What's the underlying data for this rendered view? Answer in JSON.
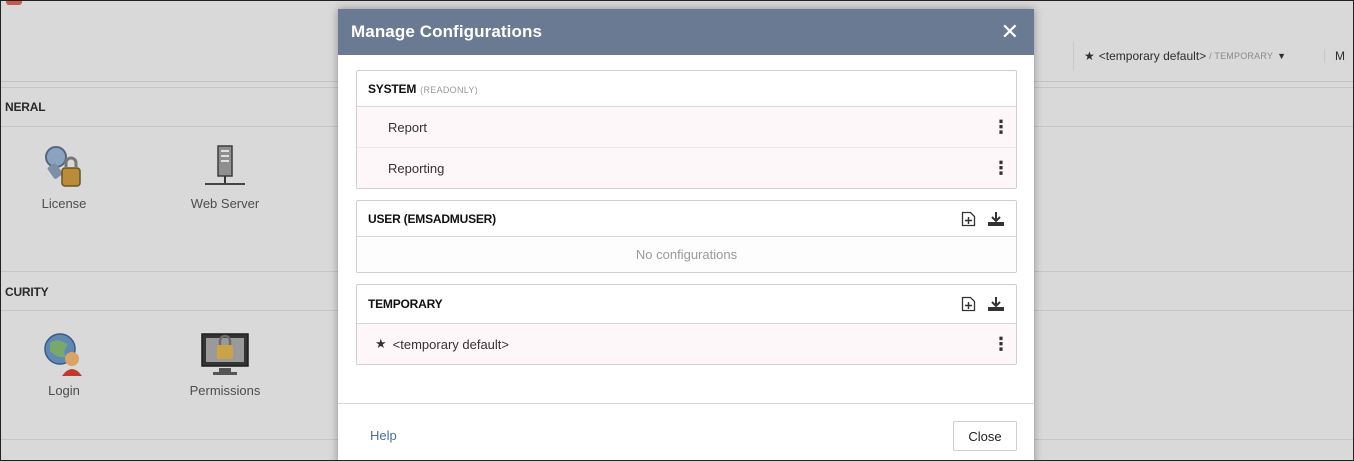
{
  "background": {
    "sections": [
      {
        "title": "NERAL",
        "tiles": [
          "License",
          "Web Server"
        ]
      },
      {
        "title": "CURITY",
        "tiles": [
          "Login",
          "Permissions"
        ]
      }
    ],
    "config_selector": {
      "current": "<temporary default>",
      "scope": "/ TEMPORARY",
      "extra": "M"
    }
  },
  "modal": {
    "title": "Manage Configurations",
    "close_icon": "close-icon",
    "panels": {
      "system": {
        "title": "SYSTEM",
        "tag": "(READONLY)",
        "items": [
          "Report",
          "Reporting"
        ]
      },
      "user": {
        "title": "USER (EMSADMUSER)",
        "empty_text": "No configurations"
      },
      "temporary": {
        "title": "TEMPORARY",
        "items": [
          "<temporary default>"
        ]
      }
    },
    "footer": {
      "help_label": "Help",
      "close_label": "Close"
    }
  }
}
